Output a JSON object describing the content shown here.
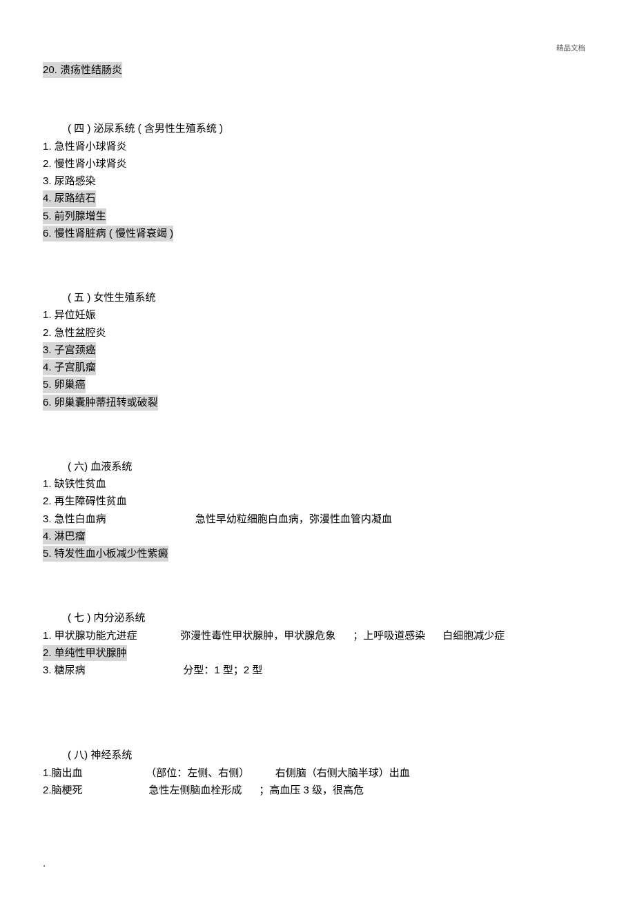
{
  "header_note": "精品文档",
  "top_item": "20. 溃疡性结肠炎",
  "sections": [
    {
      "title": "( 四 ) 泌尿系统 ( 含男性生殖系统 )",
      "items": [
        {
          "text": "1. 急性肾小球肾炎",
          "highlight": false
        },
        {
          "text": "2. 慢性肾小球肾炎",
          "highlight": false
        },
        {
          "text": "3. 尿路感染",
          "highlight": false
        },
        {
          "text": "4. 尿路结石",
          "highlight": true
        },
        {
          "text": "5. 前列腺增生",
          "highlight": true
        },
        {
          "text": "6. 慢性肾脏病 ( 慢性肾衰竭 )",
          "highlight": true
        }
      ]
    },
    {
      "title": "( 五 ) 女性生殖系统",
      "items": [
        {
          "text": "1. 异位妊娠",
          "highlight": false
        },
        {
          "text": "2. 急性盆腔炎",
          "highlight": false
        },
        {
          "text": "3. 子宫颈癌",
          "highlight": true
        },
        {
          "text": "4. 子宫肌瘤",
          "highlight": true
        },
        {
          "text": "5. 卵巢癌",
          "highlight": true
        },
        {
          "text": "6. 卵巢囊肿蒂扭转或破裂",
          "highlight": true
        }
      ]
    },
    {
      "title": "( 六) 血液系统",
      "items": [
        {
          "text": "1. 缺铁性贫血",
          "highlight": false
        },
        {
          "text": "2. 再生障碍性贫血",
          "highlight": false
        },
        {
          "text": "3. 急性白血病",
          "highlight": false,
          "extra": "                               急性早幼粒细胞白血病，弥漫性血管内凝血"
        },
        {
          "text": "4. 淋巴瘤",
          "highlight": true
        },
        {
          "text": "5. 特发性血小板减少性紫癜",
          "highlight": true
        }
      ]
    },
    {
      "title": "( 七 ) 内分泌系统",
      "items": [
        {
          "text": "1. 甲状腺功能亢进症",
          "highlight": false,
          "extra": "               弥漫性毒性甲状腺肿，甲状腺危象      ；上呼吸道感染      白细胞减少症"
        },
        {
          "text": "2. 单纯性甲状腺肿",
          "highlight": true
        },
        {
          "text": "3. 糖尿病",
          "highlight": false,
          "extra": "                                  分型：1 型；2 型"
        }
      ]
    },
    {
      "title": "( 八) 神经系统",
      "items": [
        {
          "text": "1.脑出血",
          "highlight": false,
          "extra": "                      （部位：左侧、右侧）         右侧脑（右侧大脑半球）出血"
        },
        {
          "text": "2.脑梗死",
          "highlight": false,
          "extra": "                       急性左侧脑血栓形成      ；高血压 3 级，很高危"
        }
      ]
    }
  ],
  "footer_dot": "."
}
